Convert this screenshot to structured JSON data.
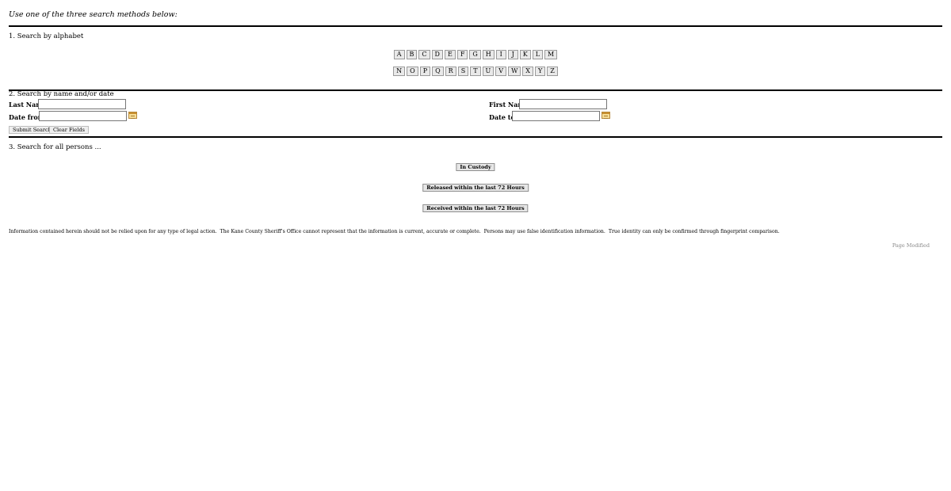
{
  "intro_text": "Use one of the three search methods below:",
  "section1": {
    "title": "1. Search by alphabet",
    "row1": [
      "A",
      "B",
      "C",
      "D",
      "E",
      "F",
      "G",
      "H",
      "I",
      "J",
      "K",
      "L",
      "M"
    ],
    "row2": [
      "N",
      "O",
      "P",
      "Q",
      "R",
      "S",
      "T",
      "U",
      "V",
      "W",
      "X",
      "Y",
      "Z"
    ]
  },
  "section2": {
    "title": "2. Search by name and/or date",
    "last_name_label": "Last Name",
    "last_name_value": "",
    "first_name_label": "First Name",
    "first_name_value": "",
    "date_from_label": "Date from",
    "date_from_value": "",
    "date_to_label": "Date to",
    "date_to_value": "",
    "submit_label": "Submit Search",
    "clear_label": "Clear Fields"
  },
  "section3": {
    "title": "3. Search for all persons ...",
    "in_custody_label": "In Custody",
    "released_label": "Released within the last 72 Hours",
    "received_label": "Received within the last 72 Hours"
  },
  "disclaimer": "Information contained herein should not be relied upon for any type of legal action.  The Kane County Sheriff's Office cannot represent that the information is current, accurate or complete.  Persons may use false identification information.  True identity can only be confirmed through fingerprint comparison.",
  "page_modified": "Page Modified",
  "colors": {
    "calendar_icon": "#f6dd97",
    "button_face": "#e9e9e9"
  }
}
